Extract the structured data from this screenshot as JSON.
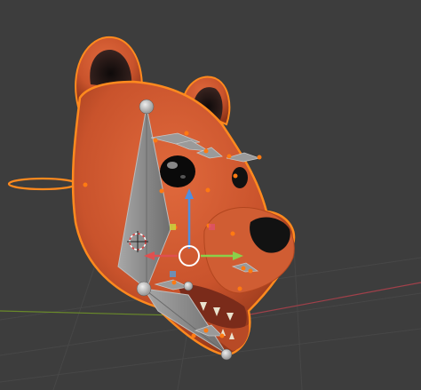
{
  "viewport": {
    "background": "#3d3d3d",
    "grid_color": "#474747",
    "x_axis_color": "#a0404a",
    "y_axis_color": "#6a8a2a"
  },
  "scene": {
    "object": "bear-head-mesh",
    "mesh_color": "#c9532c",
    "mesh_shadow": "#8e3418",
    "selection_outline": "#ff8a1e",
    "ear_inner": "#1c1414",
    "nose": "#121212",
    "eye": "#0a0a0a",
    "bone_color": "#8f8f8f",
    "bone_edge": "#bdbdbd",
    "bone_joint": "#d6d6d6"
  },
  "gizmo": {
    "x_color": "#e05050",
    "y_color": "#8bd04a",
    "z_color": "#4f8fe0",
    "center_ring": "#ffffff"
  },
  "icons": [
    "3d-cursor-icon",
    "transform-gizmo-icon"
  ]
}
